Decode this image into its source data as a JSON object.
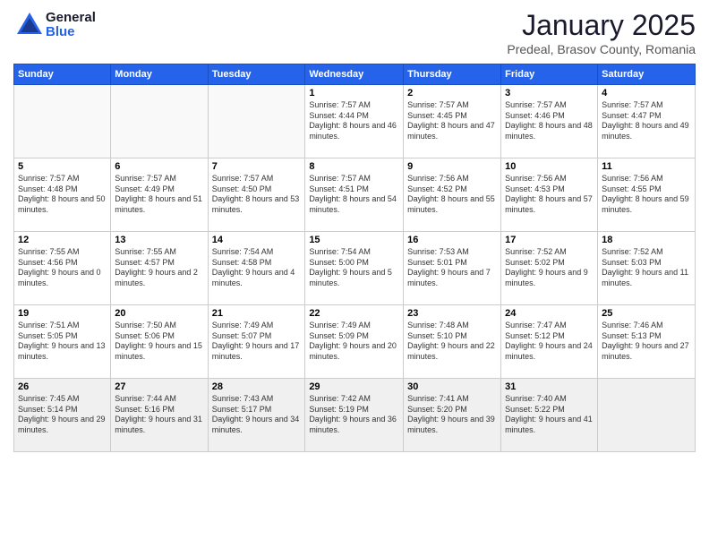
{
  "logo": {
    "general": "General",
    "blue": "Blue"
  },
  "header": {
    "title": "January 2025",
    "location": "Predeal, Brasov County, Romania"
  },
  "weekdays": [
    "Sunday",
    "Monday",
    "Tuesday",
    "Wednesday",
    "Thursday",
    "Friday",
    "Saturday"
  ],
  "weeks": [
    [
      {
        "day": "",
        "info": ""
      },
      {
        "day": "",
        "info": ""
      },
      {
        "day": "",
        "info": ""
      },
      {
        "day": "1",
        "info": "Sunrise: 7:57 AM\nSunset: 4:44 PM\nDaylight: 8 hours\nand 46 minutes."
      },
      {
        "day": "2",
        "info": "Sunrise: 7:57 AM\nSunset: 4:45 PM\nDaylight: 8 hours\nand 47 minutes."
      },
      {
        "day": "3",
        "info": "Sunrise: 7:57 AM\nSunset: 4:46 PM\nDaylight: 8 hours\nand 48 minutes."
      },
      {
        "day": "4",
        "info": "Sunrise: 7:57 AM\nSunset: 4:47 PM\nDaylight: 8 hours\nand 49 minutes."
      }
    ],
    [
      {
        "day": "5",
        "info": "Sunrise: 7:57 AM\nSunset: 4:48 PM\nDaylight: 8 hours\nand 50 minutes."
      },
      {
        "day": "6",
        "info": "Sunrise: 7:57 AM\nSunset: 4:49 PM\nDaylight: 8 hours\nand 51 minutes."
      },
      {
        "day": "7",
        "info": "Sunrise: 7:57 AM\nSunset: 4:50 PM\nDaylight: 8 hours\nand 53 minutes."
      },
      {
        "day": "8",
        "info": "Sunrise: 7:57 AM\nSunset: 4:51 PM\nDaylight: 8 hours\nand 54 minutes."
      },
      {
        "day": "9",
        "info": "Sunrise: 7:56 AM\nSunset: 4:52 PM\nDaylight: 8 hours\nand 55 minutes."
      },
      {
        "day": "10",
        "info": "Sunrise: 7:56 AM\nSunset: 4:53 PM\nDaylight: 8 hours\nand 57 minutes."
      },
      {
        "day": "11",
        "info": "Sunrise: 7:56 AM\nSunset: 4:55 PM\nDaylight: 8 hours\nand 59 minutes."
      }
    ],
    [
      {
        "day": "12",
        "info": "Sunrise: 7:55 AM\nSunset: 4:56 PM\nDaylight: 9 hours\nand 0 minutes."
      },
      {
        "day": "13",
        "info": "Sunrise: 7:55 AM\nSunset: 4:57 PM\nDaylight: 9 hours\nand 2 minutes."
      },
      {
        "day": "14",
        "info": "Sunrise: 7:54 AM\nSunset: 4:58 PM\nDaylight: 9 hours\nand 4 minutes."
      },
      {
        "day": "15",
        "info": "Sunrise: 7:54 AM\nSunset: 5:00 PM\nDaylight: 9 hours\nand 5 minutes."
      },
      {
        "day": "16",
        "info": "Sunrise: 7:53 AM\nSunset: 5:01 PM\nDaylight: 9 hours\nand 7 minutes."
      },
      {
        "day": "17",
        "info": "Sunrise: 7:52 AM\nSunset: 5:02 PM\nDaylight: 9 hours\nand 9 minutes."
      },
      {
        "day": "18",
        "info": "Sunrise: 7:52 AM\nSunset: 5:03 PM\nDaylight: 9 hours\nand 11 minutes."
      }
    ],
    [
      {
        "day": "19",
        "info": "Sunrise: 7:51 AM\nSunset: 5:05 PM\nDaylight: 9 hours\nand 13 minutes."
      },
      {
        "day": "20",
        "info": "Sunrise: 7:50 AM\nSunset: 5:06 PM\nDaylight: 9 hours\nand 15 minutes."
      },
      {
        "day": "21",
        "info": "Sunrise: 7:49 AM\nSunset: 5:07 PM\nDaylight: 9 hours\nand 17 minutes."
      },
      {
        "day": "22",
        "info": "Sunrise: 7:49 AM\nSunset: 5:09 PM\nDaylight: 9 hours\nand 20 minutes."
      },
      {
        "day": "23",
        "info": "Sunrise: 7:48 AM\nSunset: 5:10 PM\nDaylight: 9 hours\nand 22 minutes."
      },
      {
        "day": "24",
        "info": "Sunrise: 7:47 AM\nSunset: 5:12 PM\nDaylight: 9 hours\nand 24 minutes."
      },
      {
        "day": "25",
        "info": "Sunrise: 7:46 AM\nSunset: 5:13 PM\nDaylight: 9 hours\nand 27 minutes."
      }
    ],
    [
      {
        "day": "26",
        "info": "Sunrise: 7:45 AM\nSunset: 5:14 PM\nDaylight: 9 hours\nand 29 minutes."
      },
      {
        "day": "27",
        "info": "Sunrise: 7:44 AM\nSunset: 5:16 PM\nDaylight: 9 hours\nand 31 minutes."
      },
      {
        "day": "28",
        "info": "Sunrise: 7:43 AM\nSunset: 5:17 PM\nDaylight: 9 hours\nand 34 minutes."
      },
      {
        "day": "29",
        "info": "Sunrise: 7:42 AM\nSunset: 5:19 PM\nDaylight: 9 hours\nand 36 minutes."
      },
      {
        "day": "30",
        "info": "Sunrise: 7:41 AM\nSunset: 5:20 PM\nDaylight: 9 hours\nand 39 minutes."
      },
      {
        "day": "31",
        "info": "Sunrise: 7:40 AM\nSunset: 5:22 PM\nDaylight: 9 hours\nand 41 minutes."
      },
      {
        "day": "",
        "info": ""
      }
    ]
  ]
}
